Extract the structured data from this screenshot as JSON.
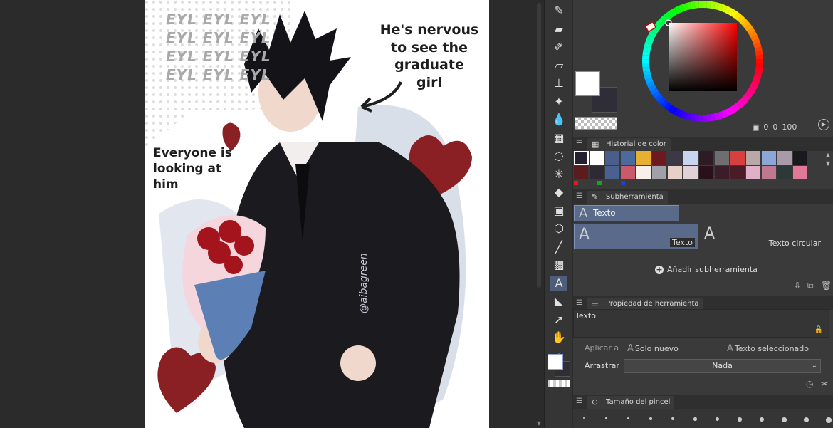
{
  "artwork": {
    "caption_right": "He's nervous to see the graduate girl",
    "caption_left": "Everyone is looking at him",
    "pattern_text": [
      "EYL EYL EYL",
      "EYL EYL EYL",
      "EYL EYL EYL",
      "EYL EYL EYL"
    ],
    "watermark": "@aibagreen"
  },
  "toolbar": {
    "tools": [
      {
        "name": "pen-tool-icon",
        "glyph": "✎"
      },
      {
        "name": "brush-tool-icon",
        "glyph": "▰"
      },
      {
        "name": "pencil-tool-icon",
        "glyph": "✐"
      },
      {
        "name": "eraser-tool-icon",
        "glyph": "▱"
      },
      {
        "name": "airbrush-tool-icon",
        "glyph": "⊥"
      },
      {
        "name": "decoration-tool-icon",
        "glyph": "✦"
      },
      {
        "name": "blend-tool-icon",
        "glyph": "💧"
      },
      {
        "name": "grid-tool-icon",
        "glyph": "▦"
      },
      {
        "name": "lasso-tool-icon",
        "glyph": "◌"
      },
      {
        "name": "auto-select-icon",
        "glyph": "✳"
      },
      {
        "name": "fill-tool-icon",
        "glyph": "◆"
      },
      {
        "name": "gradient-tool-icon",
        "glyph": "▣"
      },
      {
        "name": "3d-object-icon",
        "glyph": "⬡"
      },
      {
        "name": "line-tool-icon",
        "glyph": "╱"
      },
      {
        "name": "tone-tool-icon",
        "glyph": "▩"
      },
      {
        "name": "text-tool-icon",
        "glyph": "A"
      },
      {
        "name": "frame-tool-icon",
        "glyph": "◣"
      },
      {
        "name": "operation-tool-icon",
        "glyph": "➚"
      },
      {
        "name": "hand-tool-icon",
        "glyph": "✋"
      },
      {
        "name": "eyedropper-tool-icon",
        "glyph": "✒"
      }
    ]
  },
  "color": {
    "main": "#ffffff",
    "sub": "#2f2d38",
    "readout": {
      "h": "0",
      "s": "0",
      "v": "100"
    }
  },
  "history": {
    "title": "Historial de color",
    "row1": [
      "#24202e",
      "#ffffff",
      "#4a5e8c",
      "#4d6a9e",
      "#e8b030",
      "#6e1820",
      "#3c3846",
      "#c8d4f0",
      "#2e1c24",
      "#6e6e70",
      "#d84040",
      "#b8a8a8",
      "#8ca6d8",
      "#a89aa8",
      "#1a1a1e"
    ],
    "row2": [
      "#5a1c1c",
      "#2e2a34",
      "#4a6090",
      "#c85a6a",
      "#f8f0e8",
      "#a0a0a8",
      "#e8d0c8",
      "#e0d0d8",
      "#2a1018",
      "#3c1c28",
      "#4a1c28",
      "#e0b0c8",
      "#c07890",
      "#2e3838",
      "#e07898"
    ],
    "indicators": [
      "#d82020",
      "#20a020",
      "#2040d0"
    ]
  },
  "subtool": {
    "title": "Subherramienta",
    "group": "Texto",
    "items": [
      "Texto",
      "Texto circular"
    ],
    "add_label": "Añadir subherramienta"
  },
  "toolprop": {
    "title": "Propiedad de herramienta",
    "name": "Texto",
    "apply_label": "Aplicar a",
    "apply_options": [
      "Solo nuevo",
      "Texto seleccionado"
    ],
    "drag_label": "Arrastrar",
    "drag_value": "Nada"
  },
  "brush": {
    "title": "Tamaño del pincel"
  }
}
